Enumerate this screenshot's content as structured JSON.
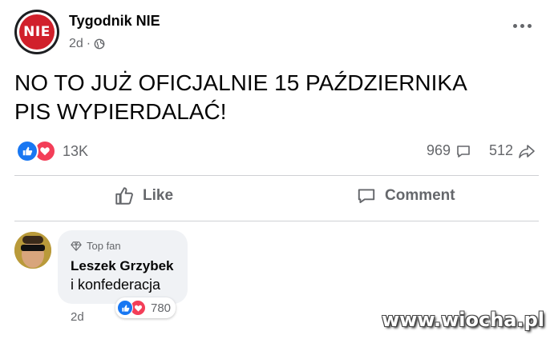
{
  "post": {
    "page_name": "Tygodnik NIE",
    "avatar_text": "NIE",
    "time": "2d",
    "meta_separator": "·",
    "text": "NO TO JUŻ OFICJALNIE 15 PAŹDZIERNIKA\nPIS WYPIERDALAĆ!",
    "reaction_count": "13K",
    "comment_count": "969",
    "share_count": "512",
    "privacy_icon": "globe-icon",
    "more_icon": "more-icon"
  },
  "actions": {
    "like_label": "Like",
    "comment_label": "Comment"
  },
  "comment": {
    "badge": "Top fan",
    "author": "Leszek Grzybek",
    "text": "i konfederacja",
    "reaction_count": "780",
    "time": "2d"
  },
  "colors": {
    "like_blue": "#1877f2",
    "love_red": "#f33e58",
    "brand_red": "#d1202b"
  },
  "watermark": "www.wiocha.pl"
}
